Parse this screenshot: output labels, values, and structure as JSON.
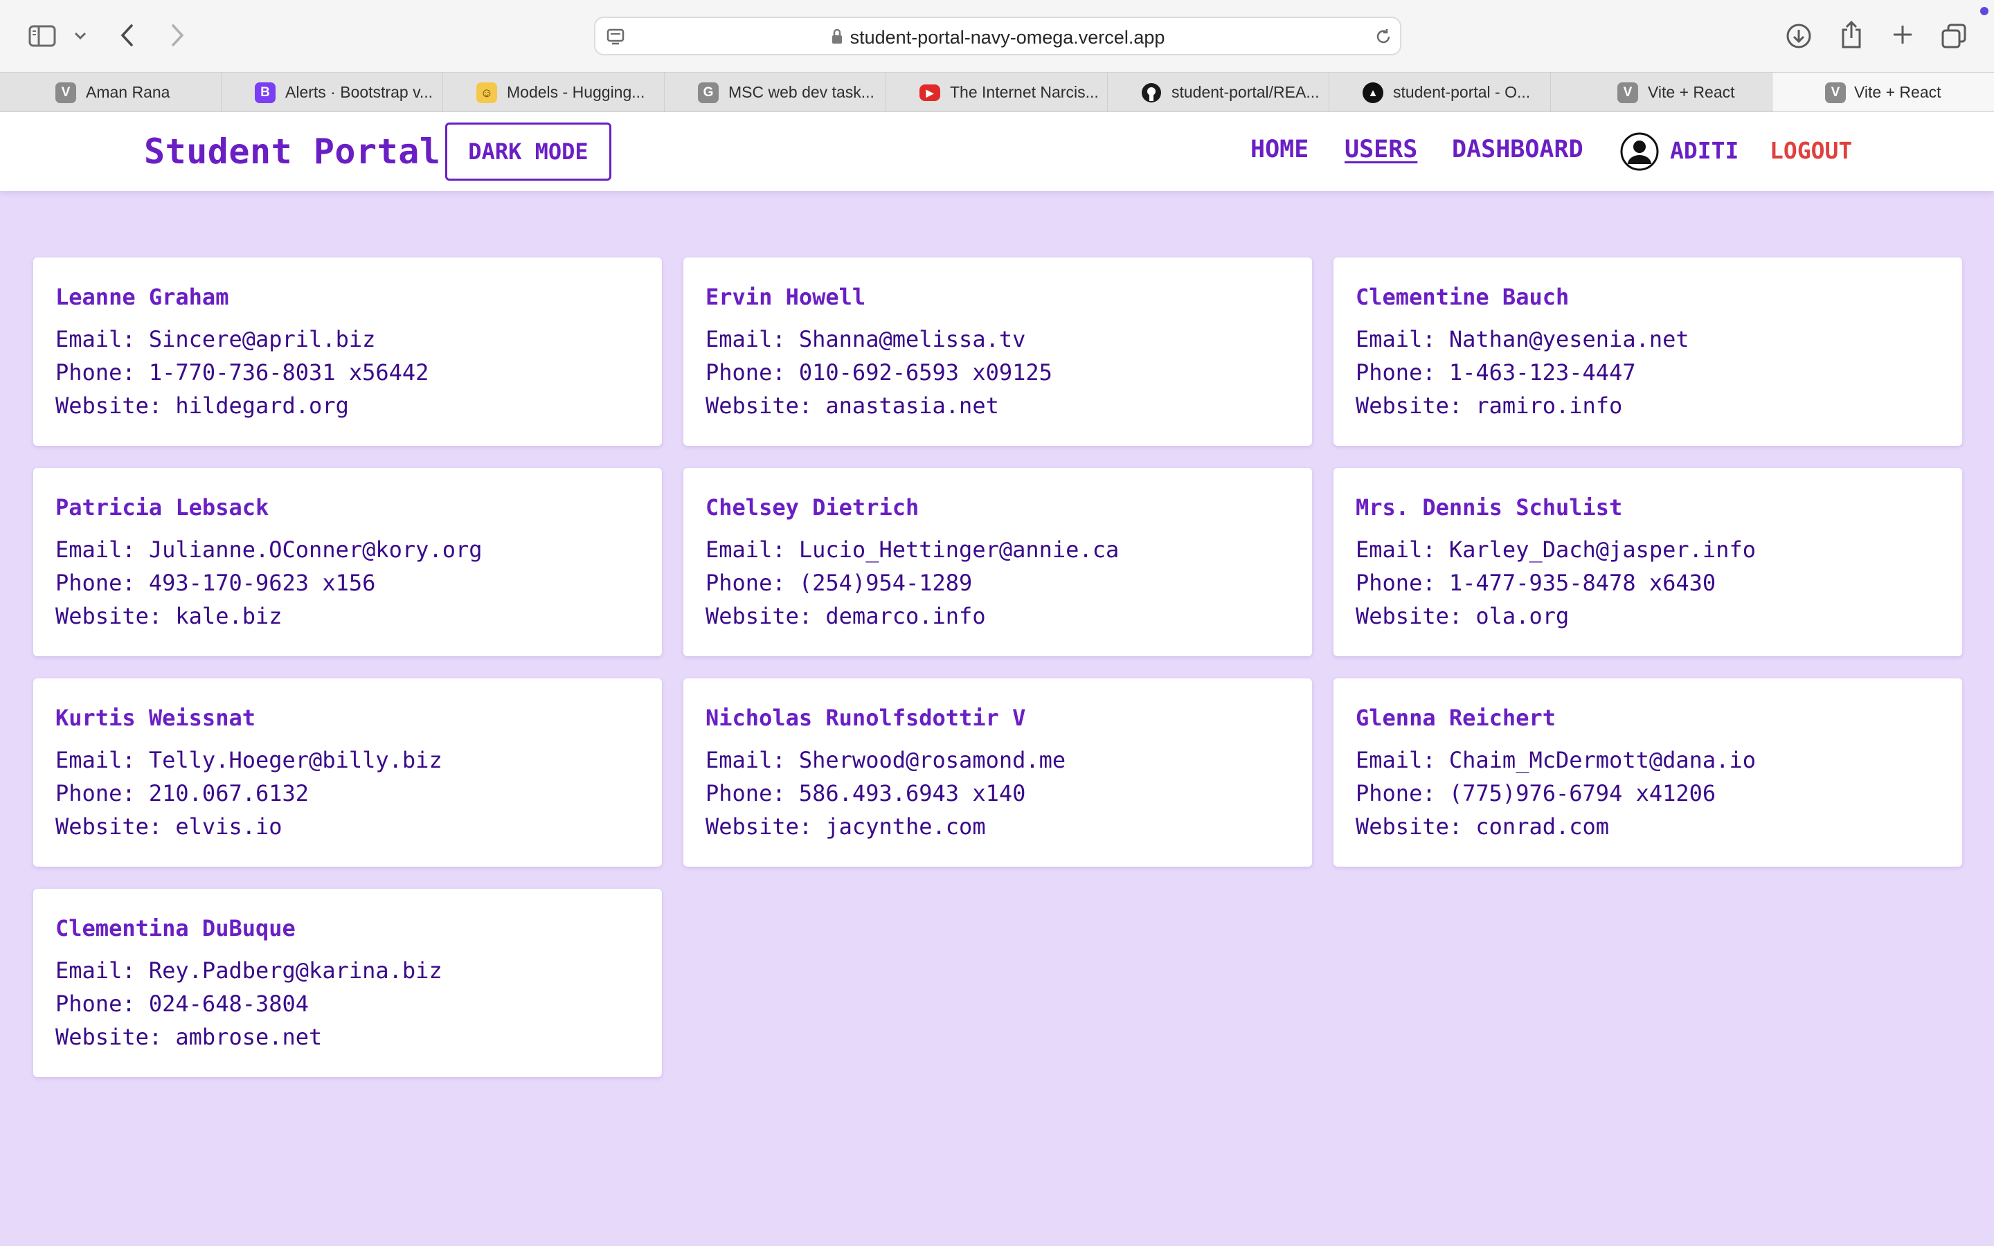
{
  "browser": {
    "url": "student-portal-navy-omega.vercel.app",
    "tabs": [
      {
        "label": "Aman Rana",
        "icon": "V",
        "color": "#8a8a8a"
      },
      {
        "label": "Alerts · Bootstrap v...",
        "icon": "B",
        "color": "#7a3ff2"
      },
      {
        "label": "Models - Hugging...",
        "icon": "🤗",
        "color": "#f5c84b"
      },
      {
        "label": "MSC web dev task...",
        "icon": "G",
        "color": "#8a8a8a"
      },
      {
        "label": "The Internet Narcis...",
        "icon": "▶",
        "color": "#e02a2a"
      },
      {
        "label": "student-portal/REA...",
        "icon": "github",
        "color": "#1b1b1b"
      },
      {
        "label": "student-portal - O...",
        "icon": "▲",
        "color": "#111111"
      },
      {
        "label": "Vite + React",
        "icon": "V",
        "color": "#8a8a8a"
      },
      {
        "label": "Vite + React",
        "icon": "V",
        "color": "#8a8a8a"
      }
    ]
  },
  "nav": {
    "brand": "Student Portal",
    "dark_mode": "DARK MODE",
    "home": "HOME",
    "users": "USERS",
    "dashboard": "DASHBOARD",
    "user": "ADITI",
    "logout": "LOGOUT"
  },
  "labels": {
    "email": "Email: ",
    "phone": "Phone: ",
    "website": "Website: "
  },
  "users": [
    {
      "name": "Leanne Graham",
      "email": "Sincere@april.biz",
      "phone": "1-770-736-8031 x56442",
      "website": "hildegard.org"
    },
    {
      "name": "Ervin Howell",
      "email": "Shanna@melissa.tv",
      "phone": "010-692-6593 x09125",
      "website": "anastasia.net"
    },
    {
      "name": "Clementine Bauch",
      "email": "Nathan@yesenia.net",
      "phone": "1-463-123-4447",
      "website": "ramiro.info"
    },
    {
      "name": "Patricia Lebsack",
      "email": "Julianne.OConner@kory.org",
      "phone": "493-170-9623 x156",
      "website": "kale.biz"
    },
    {
      "name": "Chelsey Dietrich",
      "email": "Lucio_Hettinger@annie.ca",
      "phone": "(254)954-1289",
      "website": "demarco.info"
    },
    {
      "name": "Mrs. Dennis Schulist",
      "email": "Karley_Dach@jasper.info",
      "phone": "1-477-935-8478 x6430",
      "website": "ola.org"
    },
    {
      "name": "Kurtis Weissnat",
      "email": "Telly.Hoeger@billy.biz",
      "phone": "210.067.6132",
      "website": "elvis.io"
    },
    {
      "name": "Nicholas Runolfsdottir V",
      "email": "Sherwood@rosamond.me",
      "phone": "586.493.6943 x140",
      "website": "jacynthe.com"
    },
    {
      "name": "Glenna Reichert",
      "email": "Chaim_McDermott@dana.io",
      "phone": "(775)976-6794 x41206",
      "website": "conrad.com"
    },
    {
      "name": "Clementina DuBuque",
      "email": "Rey.Padberg@karina.biz",
      "phone": "024-648-3804",
      "website": "ambrose.net"
    }
  ]
}
